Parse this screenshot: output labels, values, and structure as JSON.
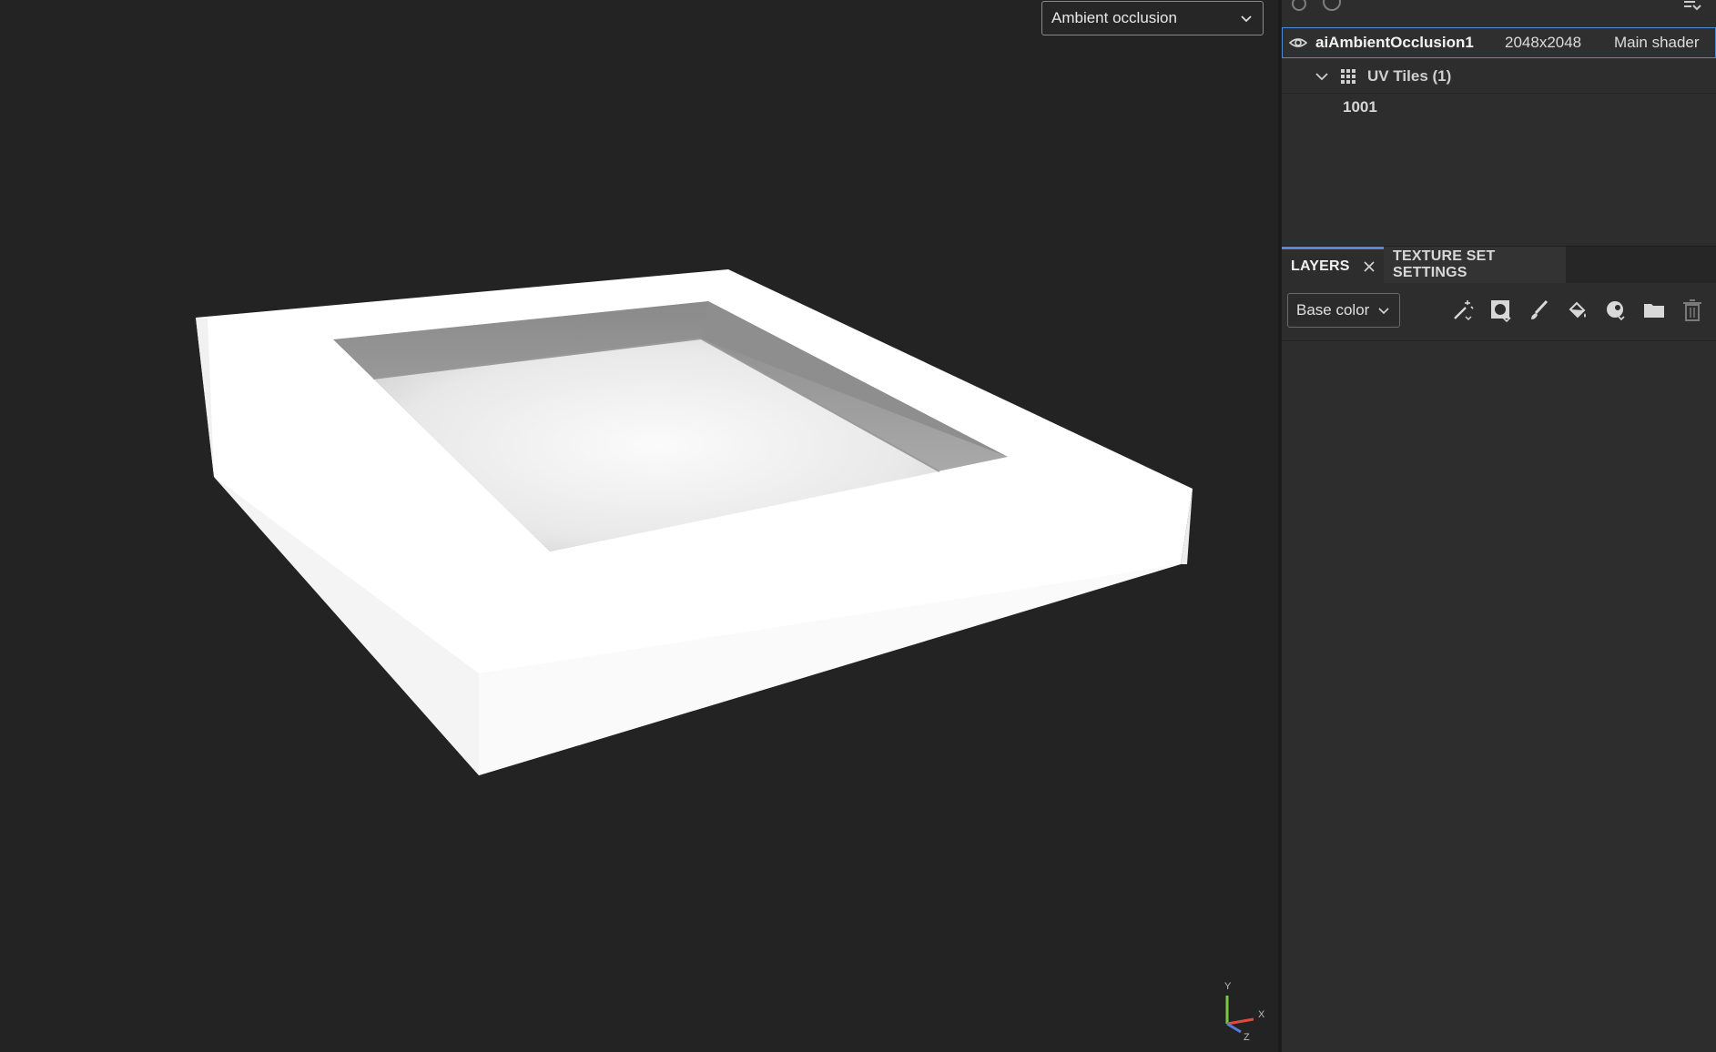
{
  "viewport": {
    "channel_select": {
      "value": "Ambient occlusion"
    },
    "axis": {
      "x": "X",
      "y": "Y",
      "z": "Z"
    }
  },
  "texture_set": {
    "name": "aiAmbientOcclusion1",
    "resolution": "2048x2048",
    "shader": "Main shader",
    "uv_tiles_label": "UV Tiles (1)",
    "tiles": [
      "1001"
    ]
  },
  "tabs": {
    "layers": "LAYERS",
    "texture_set_settings": "TEXTURE SET SETTINGS"
  },
  "layers_toolbar": {
    "channel": "Base color",
    "tools": [
      "magic-wand-icon",
      "smart-mask-icon",
      "paint-brush-icon",
      "fill-bucket-icon",
      "effects-icon",
      "folder-icon",
      "trash-icon"
    ]
  },
  "colors": {
    "accent": "#4f8bd6",
    "viewport_bg": "#232323",
    "panel_bg": "#2d2d2d"
  }
}
